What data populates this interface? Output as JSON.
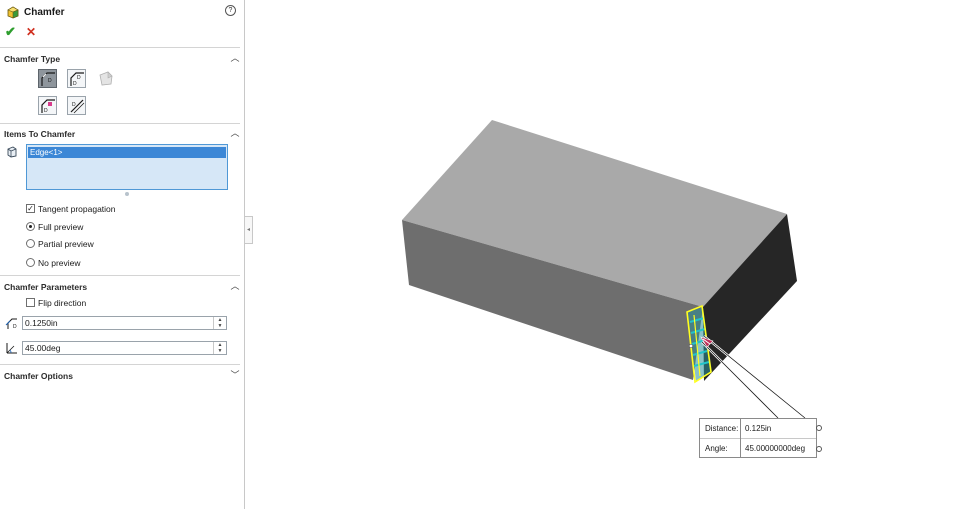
{
  "panel": {
    "title": "Chamfer",
    "help_icon": "help-icon",
    "sections": {
      "chamfer_type": {
        "title": "Chamfer Type",
        "selected_index": 0,
        "buttons": [
          "angle-distance-icon",
          "distance-distance-icon",
          "vertex-icon",
          "offset-face-icon",
          "face-face-icon"
        ]
      },
      "items_to_chamfer": {
        "title": "Items To Chamfer",
        "items": [
          "Edge<1>"
        ],
        "tangent_propagation": {
          "label": "Tangent propagation",
          "checked": true
        },
        "preview_options": [
          {
            "label": "Full preview",
            "selected": true
          },
          {
            "label": "Partial preview",
            "selected": false
          },
          {
            "label": "No preview",
            "selected": false
          }
        ]
      },
      "chamfer_parameters": {
        "title": "Chamfer Parameters",
        "flip_direction": {
          "label": "Flip direction",
          "checked": false
        },
        "distance_value": "0.1250in",
        "angle_value": "45.00deg"
      },
      "chamfer_options": {
        "title": "Chamfer Options"
      }
    }
  },
  "callout": {
    "distance_label": "Distance:",
    "distance_value": "0.125in",
    "angle_label": "Angle:",
    "angle_value": "45.00000000deg"
  },
  "colors": {
    "top_face": "#a9a9a9",
    "front_face": "#6e6e6e",
    "side_face": "#262626",
    "edge_highlight": "#ffff20",
    "preview_hatch": "#22c3c9",
    "selection_blue": "#3c87d6"
  }
}
